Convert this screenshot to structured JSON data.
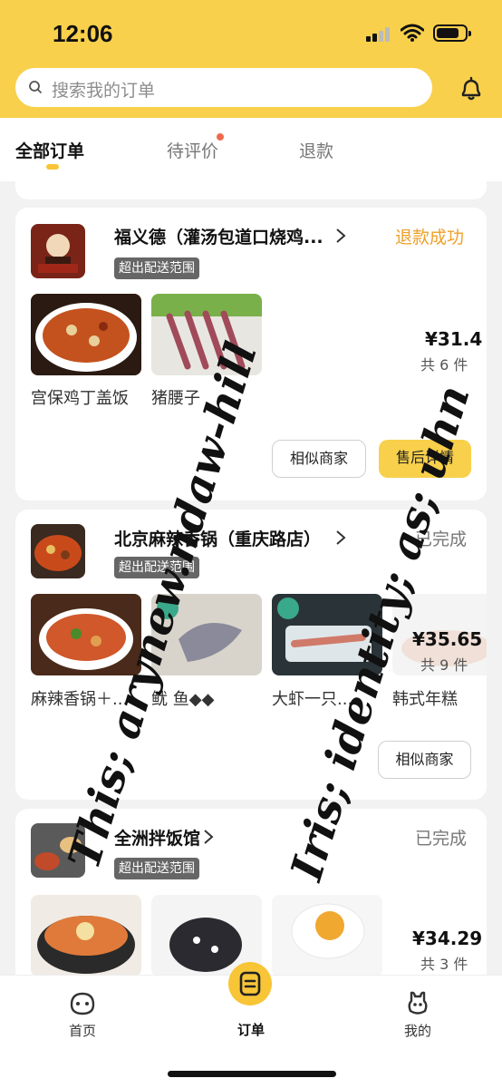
{
  "status_bar": {
    "time": "12:06"
  },
  "search": {
    "placeholder": "搜索我的订单"
  },
  "tabs": [
    {
      "label": "全部订单",
      "active": true
    },
    {
      "label": "待评价",
      "has_dot": true
    },
    {
      "label": "退款"
    }
  ],
  "orders": [
    {
      "shop": "福义德（灌汤包道口烧鸡...",
      "status": "退款成功",
      "tag": "超出配送范围",
      "items": [
        "宫保鸡丁盖饭",
        "猪腰子"
      ],
      "price": "¥31.4",
      "count": "共 6 件",
      "buttons": [
        "相似商家",
        "售后详情"
      ]
    },
    {
      "shop": "北京麻辣香锅（重庆路店）",
      "status": "已完成",
      "tag": "超出配送范围",
      "items": [
        "麻辣香锅＋...",
        "鱿 鱼◆◆",
        "大虾一只...",
        "韩式年糕"
      ],
      "price": "¥35.65",
      "count": "共 9 件",
      "buttons": [
        "相似商家"
      ]
    },
    {
      "shop": "全洲拌饭馆",
      "status": "已完成",
      "tag": "超出配送范围",
      "price": "¥34.29",
      "count": "共 3 件"
    }
  ],
  "handwriting": [
    "This; arynew.ndaw-hill",
    "Iris; identity; as; uhn"
  ],
  "bottom_nav": [
    {
      "label": "首页",
      "icon": "home-icon"
    },
    {
      "label": "订单",
      "icon": "orders-icon",
      "active": true
    },
    {
      "label": "我的",
      "icon": "profile-icon"
    }
  ],
  "colors": {
    "brand_yellow": "#f8d04b",
    "refund_status": "#f0a028",
    "done_status": "#777777",
    "tag_bg": "#666666"
  }
}
